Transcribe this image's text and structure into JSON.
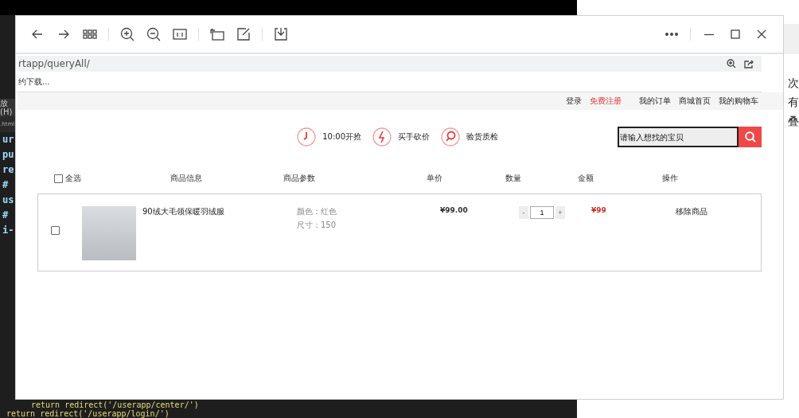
{
  "background": {
    "editor_menu": "放(H)",
    "editor_tab": ".html",
    "code_fragments": [
      "ur",
      "pu",
      "re",
      "#",
      "us",
      "#",
      "i-"
    ],
    "code_lines": [
      "return redirect('/userapp/center/')",
      "return redirect('/userapp/login/')"
    ],
    "document_fragments": [
      "次",
      "有",
      "叠"
    ]
  },
  "browser": {
    "address": "rtapp/queryAll/",
    "bookmark": "约下载..."
  },
  "top_nav": [
    {
      "label": "登录",
      "highlighted": false
    },
    {
      "label": "免费注册",
      "highlighted": true
    },
    {
      "label": "我的订单",
      "highlighted": false
    },
    {
      "label": "商城首页",
      "highlighted": false
    },
    {
      "label": "我的购物车",
      "highlighted": false
    }
  ],
  "features": [
    {
      "kind": "clock",
      "label": "10:00开抢"
    },
    {
      "kind": "bolt",
      "label": "买手砍价"
    },
    {
      "kind": "search",
      "label": "验货质检"
    }
  ],
  "search": {
    "placeholder": "请输入想找的宝贝"
  },
  "cart": {
    "select_all": {
      "label": "全选",
      "checked": false
    },
    "columns": [
      "商品信息",
      "商品参数",
      "单价",
      "数量",
      "金额",
      "操作"
    ],
    "items": [
      {
        "checked": false,
        "name": "90绒大毛领保暖羽绒服",
        "params": [
          "颜色：红色",
          "尺寸：150"
        ],
        "price": "¥99.00",
        "minus": "-",
        "quantity": "1",
        "plus": "+",
        "amount": "¥99",
        "action": "移除商品"
      }
    ]
  }
}
